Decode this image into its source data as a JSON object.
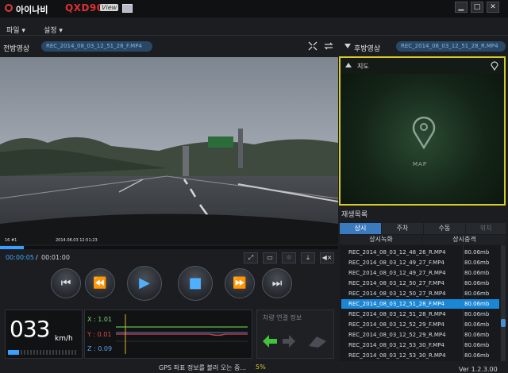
{
  "title_bar": {
    "brand": "아이나비",
    "model": "QXD900",
    "model_badge": "View",
    "buttons": [
      "minimize",
      "maximize",
      "close"
    ]
  },
  "menu": [
    {
      "label": "파일 ▾"
    },
    {
      "label": "설정 ▾"
    }
  ],
  "front": {
    "title": "전방영상",
    "file": "REC_2014_08_03_12_51_28_F.MP4"
  },
  "rear": {
    "title": "후방영상",
    "file": "REC_2014_08_03_12_51_28_R.MP4"
  },
  "video_overlay": {
    "left": "16  #1",
    "right": "2014.08.03 12:51:23"
  },
  "playback": {
    "current": "00:00:05",
    "separator": "/",
    "total": "00:01:00",
    "progress": 0.07
  },
  "speed": {
    "value": "033",
    "unit": "km/h"
  },
  "gsensor": {
    "x": "X : 1.01",
    "y": "Y : 0.01",
    "z": "Z : 0.09"
  },
  "vehicle": {
    "title": "차량 연결 정보"
  },
  "map": {
    "title": "지도",
    "label": "MAP"
  },
  "playlist": {
    "title": "재생목록",
    "tabs": [
      "상시",
      "주차",
      "수동",
      "위치"
    ],
    "columns": [
      "상시녹화",
      "상시충격"
    ],
    "rows": [
      {
        "name": "REC_2014_08_03_12_48_26_R.MP4",
        "size": "80.06mb"
      },
      {
        "name": "REC_2014_08_03_12_49_27_F.MP4",
        "size": "80.06mb"
      },
      {
        "name": "REC_2014_08_03_12_49_27_R.MP4",
        "size": "80.06mb"
      },
      {
        "name": "REC_2014_08_03_12_50_27_F.MP4",
        "size": "80.06mb"
      },
      {
        "name": "REC_2014_08_03_12_50_27_R.MP4",
        "size": "80.06mb"
      },
      {
        "name": "REC_2014_08_03_12_51_28_F.MP4",
        "size": "80.06mb"
      },
      {
        "name": "REC_2014_08_03_12_51_28_R.MP4",
        "size": "80.06mb"
      },
      {
        "name": "REC_2014_08_03_12_52_29_F.MP4",
        "size": "80.06mb"
      },
      {
        "name": "REC_2014_08_03_12_52_29_R.MP4",
        "size": "80.06mb"
      },
      {
        "name": "REC_2014_08_03_12_53_30_F.MP4",
        "size": "80.06mb"
      },
      {
        "name": "REC_2014_08_03_12_53_30_R.MP4",
        "size": "80.06mb"
      }
    ],
    "selected_index": 5
  },
  "status": {
    "message": "GPS 좌표 정보를 불러 오는 중...",
    "percent": "5%",
    "version": "Ver 1.2.3.00"
  },
  "colors": {
    "accent": "#3aa0ff",
    "highlight_border": "#d8cc2a",
    "selected_row": "#1a86d6",
    "brand_red": "#e03030"
  }
}
